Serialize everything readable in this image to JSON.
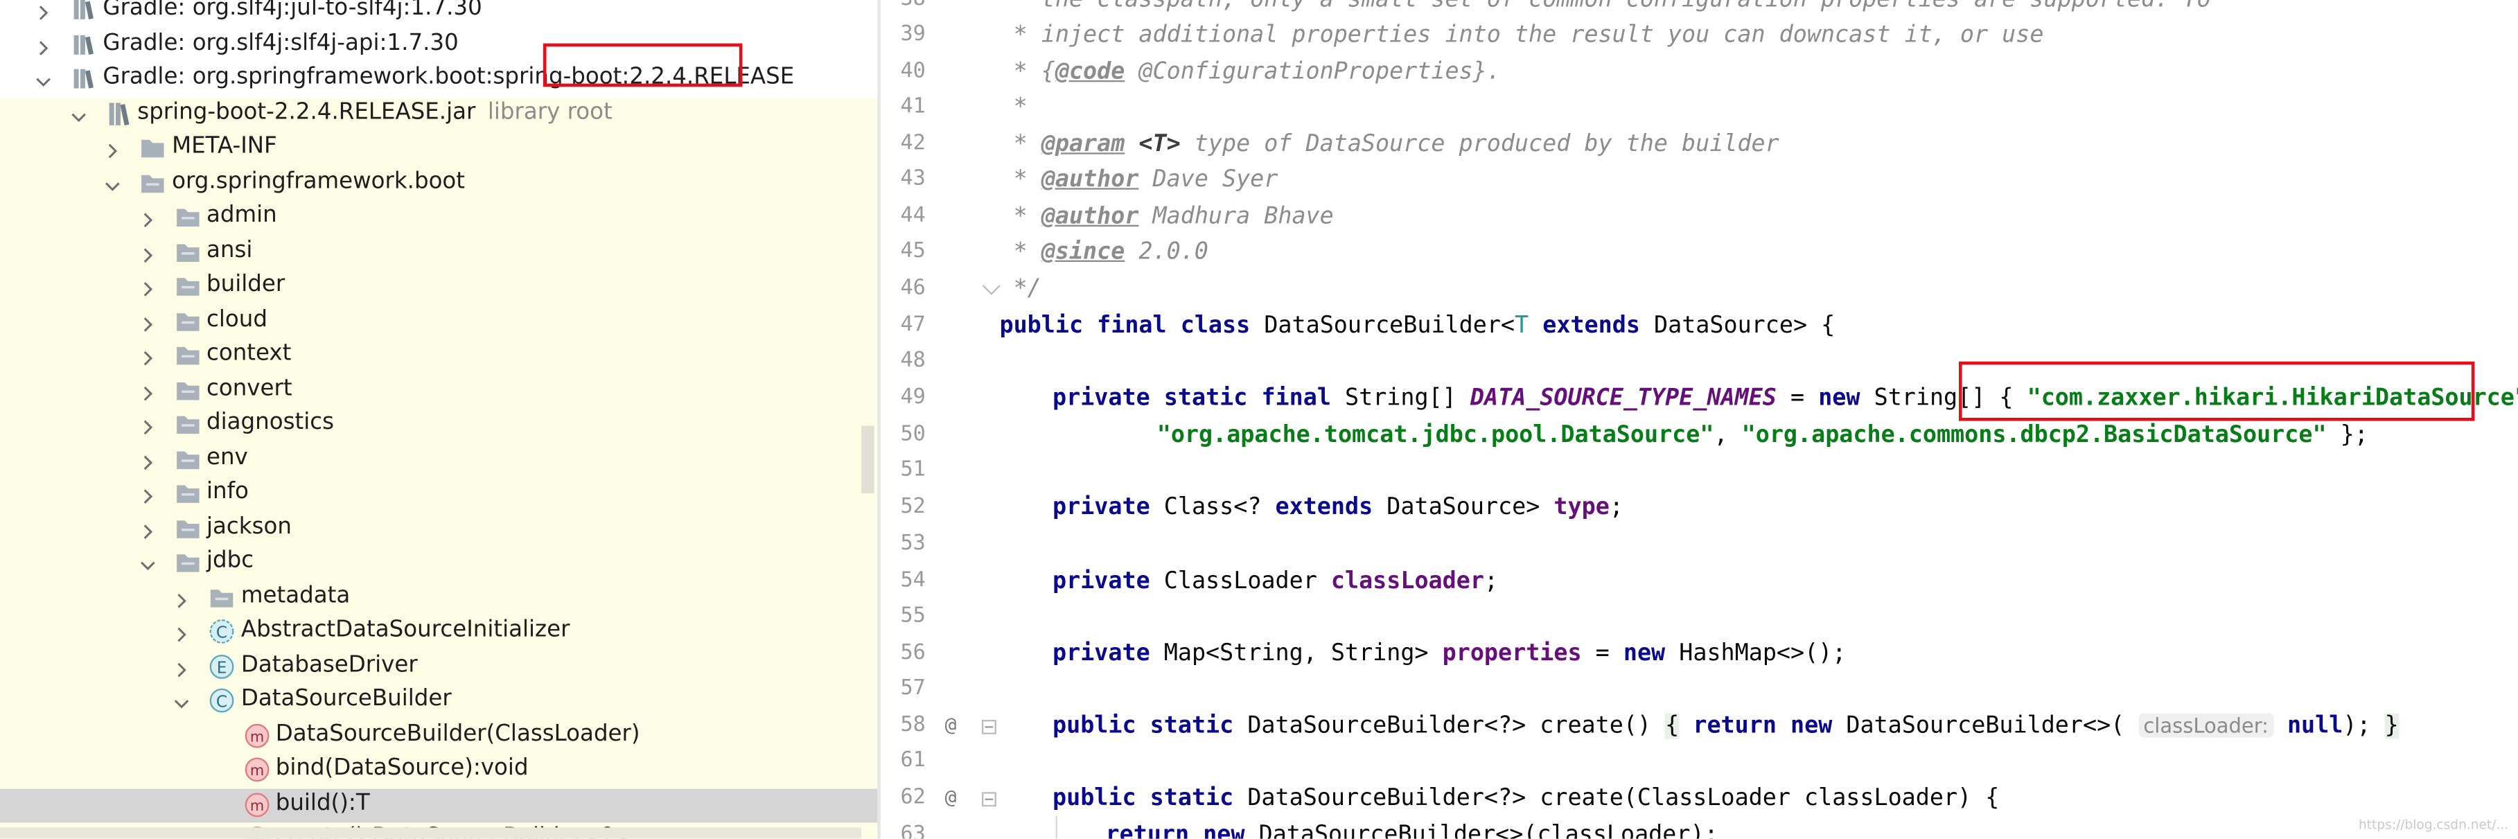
{
  "project_tree": {
    "rows": [
      {
        "label": "Gradle: org.slf4j:jul-to-slf4j:1.7.30",
        "suffix": "",
        "indent": 0,
        "arrow": "right",
        "icon": "library-icon",
        "bg": "white"
      },
      {
        "label": "Gradle: org.slf4j:slf4j-api:1.7.30",
        "suffix": "",
        "indent": 0,
        "arrow": "right",
        "icon": "library-icon",
        "bg": "white"
      },
      {
        "label": "Gradle: org.springframework.boot:spring-boot:2.2.4.RELEASE",
        "suffix": "",
        "indent": 0,
        "arrow": "down",
        "icon": "library-icon",
        "bg": "white"
      },
      {
        "label": "spring-boot-2.2.4.RELEASE.jar",
        "suffix": "library root",
        "indent": 1,
        "arrow": "down",
        "icon": "jar-icon",
        "bg": ""
      },
      {
        "label": "META-INF",
        "suffix": "",
        "indent": 2,
        "arrow": "right",
        "icon": "folder-icon",
        "bg": ""
      },
      {
        "label": "org.springframework.boot",
        "suffix": "",
        "indent": 2,
        "arrow": "down",
        "icon": "package-icon",
        "bg": ""
      },
      {
        "label": "admin",
        "suffix": "",
        "indent": 3,
        "arrow": "right",
        "icon": "package-icon",
        "bg": ""
      },
      {
        "label": "ansi",
        "suffix": "",
        "indent": 3,
        "arrow": "right",
        "icon": "package-icon",
        "bg": ""
      },
      {
        "label": "builder",
        "suffix": "",
        "indent": 3,
        "arrow": "right",
        "icon": "package-icon",
        "bg": ""
      },
      {
        "label": "cloud",
        "suffix": "",
        "indent": 3,
        "arrow": "right",
        "icon": "package-icon",
        "bg": ""
      },
      {
        "label": "context",
        "suffix": "",
        "indent": 3,
        "arrow": "right",
        "icon": "package-icon",
        "bg": ""
      },
      {
        "label": "convert",
        "suffix": "",
        "indent": 3,
        "arrow": "right",
        "icon": "package-icon",
        "bg": ""
      },
      {
        "label": "diagnostics",
        "suffix": "",
        "indent": 3,
        "arrow": "right",
        "icon": "package-icon",
        "bg": ""
      },
      {
        "label": "env",
        "suffix": "",
        "indent": 3,
        "arrow": "right",
        "icon": "package-icon",
        "bg": ""
      },
      {
        "label": "info",
        "suffix": "",
        "indent": 3,
        "arrow": "right",
        "icon": "package-icon",
        "bg": ""
      },
      {
        "label": "jackson",
        "suffix": "",
        "indent": 3,
        "arrow": "right",
        "icon": "package-icon",
        "bg": ""
      },
      {
        "label": "jdbc",
        "suffix": "",
        "indent": 3,
        "arrow": "down",
        "icon": "package-icon",
        "bg": ""
      },
      {
        "label": "metadata",
        "suffix": "",
        "indent": 4,
        "arrow": "right",
        "icon": "package-icon",
        "bg": ""
      },
      {
        "label": "AbstractDataSourceInitializer",
        "suffix": "",
        "indent": 4,
        "arrow": "right",
        "icon": "abstract-class-icon",
        "bg": ""
      },
      {
        "label": "DatabaseDriver",
        "suffix": "",
        "indent": 4,
        "arrow": "right",
        "icon": "enum-icon",
        "bg": ""
      },
      {
        "label": "DataSourceBuilder",
        "suffix": "",
        "indent": 4,
        "arrow": "down",
        "icon": "class-icon",
        "bg": ""
      },
      {
        "label": "DataSourceBuilder(ClassLoader)",
        "suffix": "",
        "indent": 5,
        "arrow": "none",
        "icon": "method-icon",
        "bg": ""
      },
      {
        "label": "bind(DataSource):void",
        "suffix": "",
        "indent": 5,
        "arrow": "none",
        "icon": "method-icon",
        "bg": ""
      },
      {
        "label": "build():T",
        "suffix": "",
        "indent": 5,
        "arrow": "none",
        "icon": "method-icon",
        "bg": "sel"
      },
      {
        "label": "create():DataSourceBuilder<?>",
        "suffix": "",
        "indent": 5,
        "arrow": "none",
        "icon": "method-icon",
        "bg": ""
      }
    ]
  },
  "editor": {
    "line_numbers": [
      "38",
      "39",
      "40",
      "41",
      "42",
      "43",
      "44",
      "45",
      "46",
      "47",
      "48",
      "49",
      "50",
      "51",
      "52",
      "53",
      "54",
      "55",
      "56",
      "57",
      "58",
      "61",
      "62",
      "63"
    ],
    "gutter_annotations": [
      {
        "line": "58",
        "text": "@"
      },
      {
        "line": "62",
        "text": "@"
      }
    ],
    "code": {
      "l38": " * the classpath, only a small set of common configuration properties are supported. To",
      "l39": " * inject additional properties into the result you can downcast it, or use",
      "l40_a": " * {",
      "l40_tag": "@code",
      "l40_b": " @ConfigurationProperties}.",
      "l41": " *",
      "l42_a": " * ",
      "l42_tag": "@param",
      "l42_b": " <T>",
      "l42_c": " type of DataSource produced by the builder",
      "l43_a": " * ",
      "l43_tag": "@author",
      "l43_b": " Dave Syer",
      "l44_a": " * ",
      "l44_tag": "@author",
      "l44_b": " Madhura Bhave",
      "l45_a": " * ",
      "l45_tag": "@since",
      "l45_b": " 2.0.0",
      "l46": " */",
      "kw_public": "public",
      "kw_final": "final",
      "kw_class": "class",
      "kw_private": "private",
      "kw_static": "static",
      "kw_new": "new",
      "kw_extends": "extends",
      "kw_return": "return",
      "kw_null": "null",
      "l47_name": "DataSourceBuilder",
      "l47_lt": "<",
      "l47_T": "T",
      "l47_rest": " DataSource> {",
      "l49_type": " String[] ",
      "l49_field": "DATA_SOURCE_TYPE_NAMES",
      "l49_eq": " = ",
      "l49_new_type": " String[] { ",
      "l49_str1": "\"com.zaxxer.hikari.HikariDataSource\"",
      "l49_comma": ",",
      "l50_str2": "\"org.apache.tomcat.jdbc.pool.DataSource\"",
      "l50_sep": ", ",
      "l50_str3": "\"org.apache.commons.dbcp2.BasicDataSource\"",
      "l50_end": " };",
      "l52_a": " Class<? ",
      "l52_b": " DataSource> ",
      "l52_field": "type",
      "l52_end": ";",
      "l54_a": " ClassLoader ",
      "l54_field": "classLoader",
      "l54_end": ";",
      "l56_a": " Map<String, String> ",
      "l56_field": "properties",
      "l56_eq": " = ",
      "l56_b": " HashMap<>();",
      "l58_a": " DataSourceBuilder<?> create() ",
      "l58_brace_open": "{",
      "l58_b": " DataSourceBuilder<>(",
      "l58_hint": "classLoader:",
      "l58_c": "); ",
      "l58_brace_close": "}",
      "l62_a": " DataSourceBuilder<?> create(ClassLoader classLoader) {",
      "l63_a": " DataSourceBuilder<>(classLoader);"
    }
  },
  "watermark": "https://blog.csdn.net/..."
}
